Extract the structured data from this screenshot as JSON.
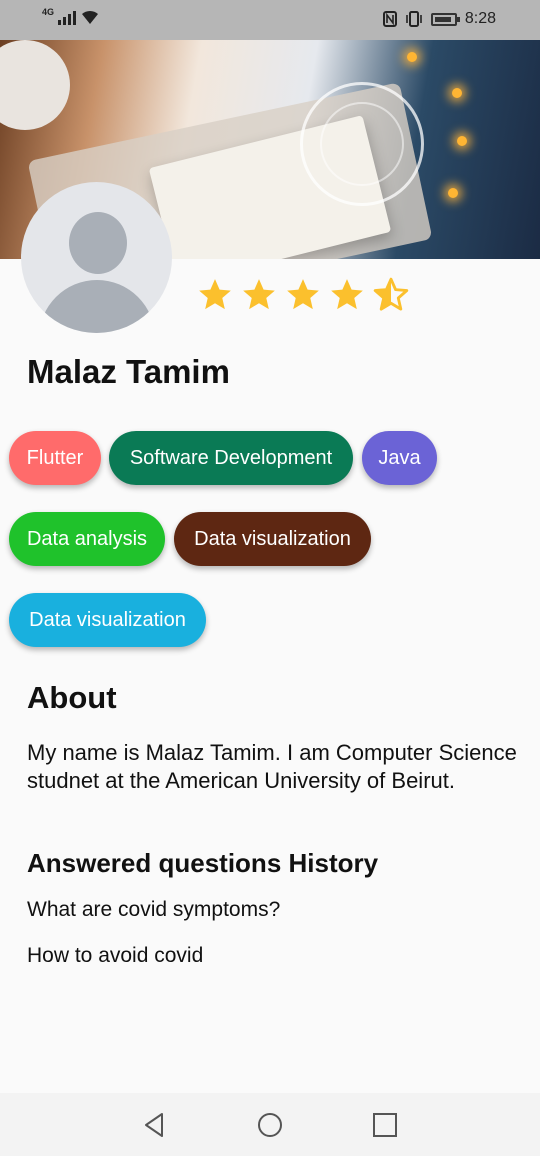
{
  "status_bar": {
    "network": "4G",
    "time": "8:28"
  },
  "profile": {
    "name": "Malaz Tamim",
    "rating": 4.5,
    "rating_max": 5
  },
  "skills": [
    {
      "label": "Flutter",
      "color": "#ff6b6b"
    },
    {
      "label": "Software Development",
      "color": "#0a7a55"
    },
    {
      "label": "Java",
      "color": "#6b63d6"
    },
    {
      "label": "Data analysis",
      "color": "#1fc22b"
    },
    {
      "label": "Data visualization",
      "color": "#5e2712"
    },
    {
      "label": "Data visualization",
      "color": "#19b0de"
    }
  ],
  "about": {
    "title": "About",
    "text": "My name is Malaz Tamim. I am  Computer Science studnet at the American University of Beirut."
  },
  "history": {
    "title": "Answered questions History",
    "questions": [
      "What are covid symptoms?",
      "How to avoid covid"
    ]
  },
  "icons": {
    "back": "triangle-back-icon",
    "home": "circle-home-icon",
    "recents": "square-recents-icon"
  },
  "colors": {
    "star": "#fbc02d"
  }
}
